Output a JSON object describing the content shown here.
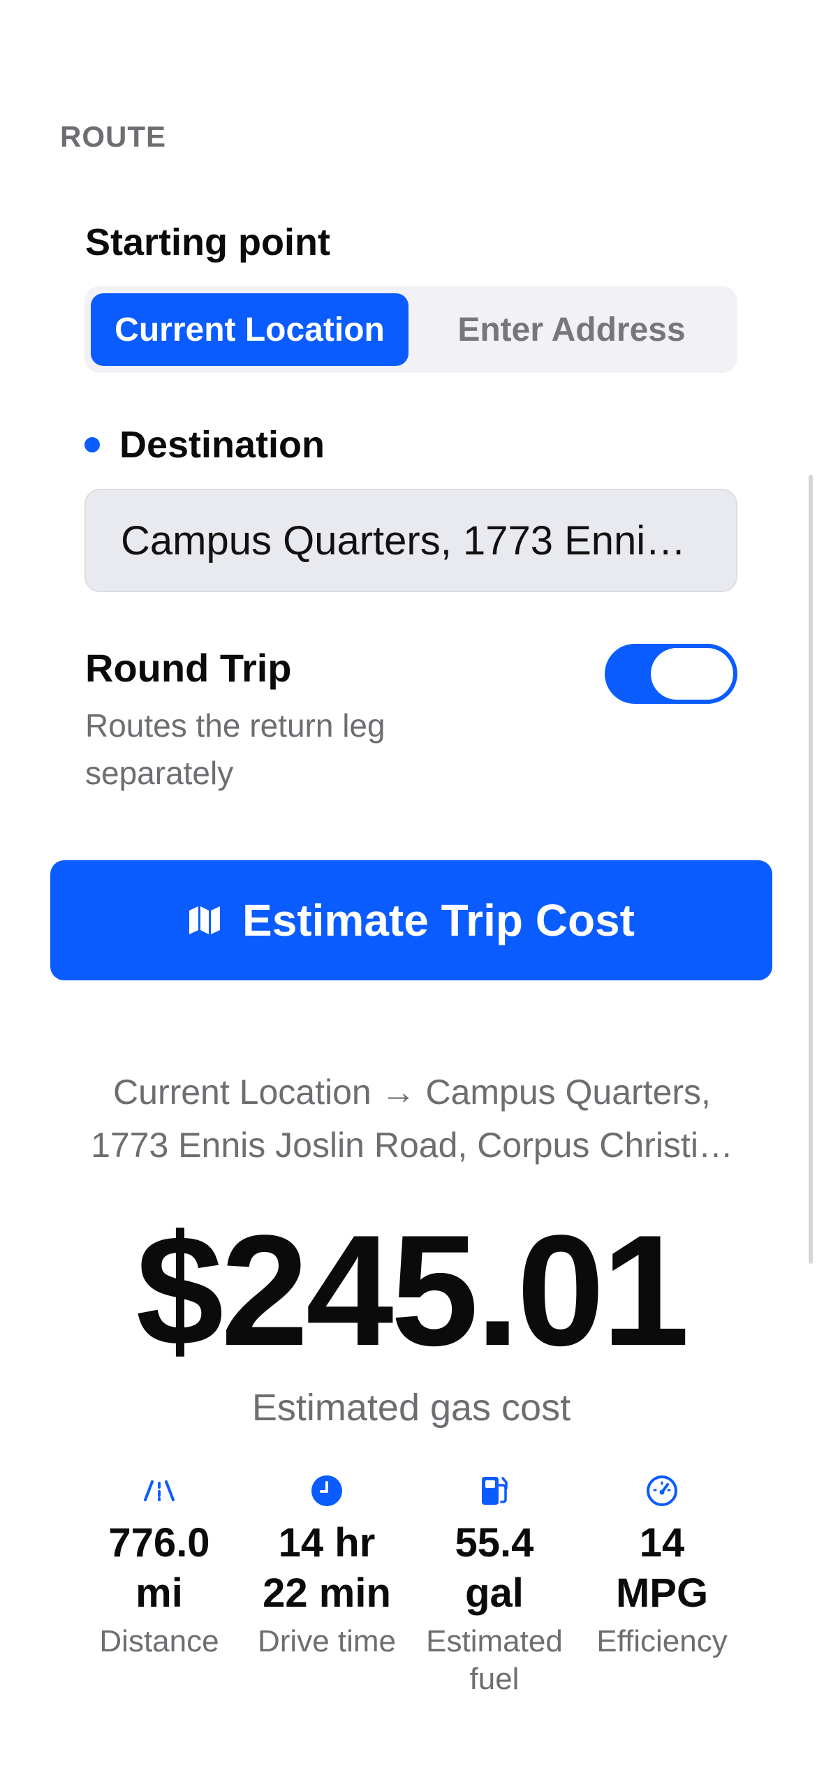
{
  "route": {
    "section_label": "ROUTE",
    "starting_point_label": "Starting point",
    "segments": [
      "Current Location",
      "Enter Address"
    ],
    "selected_segment": "Current Location",
    "destination_label": "Destination",
    "destination_value": "Campus Quarters, 1773 Ennis Joslin Road, Corpus Christi",
    "round_trip_title": "Round Trip",
    "round_trip_subtitle": "Routes the return leg separately",
    "round_trip_enabled": true,
    "estimate_button_label": "Estimate Trip Cost"
  },
  "result": {
    "summary_line1": "Current Location → Campus Quarters,",
    "summary_line2": "1773 Ennis Joslin Road, Corpus Christi…",
    "amount": "$245.01",
    "amount_caption": "Estimated gas cost",
    "stats": [
      {
        "icon": "road-icon",
        "value_line1": "776.0",
        "value_line2": "mi",
        "label": "Distance"
      },
      {
        "icon": "clock-icon",
        "value_line1": "14 hr",
        "value_line2": "22 min",
        "label": "Drive time"
      },
      {
        "icon": "fuel-pump-icon",
        "value_line1": "55.4",
        "value_line2": "gal",
        "label": "Estimated fuel"
      },
      {
        "icon": "speedometer-icon",
        "value_line1": "14",
        "value_line2": "MPG",
        "label": "Efficiency"
      }
    ]
  },
  "colors": {
    "accent": "#0a5cff",
    "secondary_text": "#6d6d72",
    "field_background": "#e9eaef",
    "segmented_background": "#f1f1f6"
  }
}
